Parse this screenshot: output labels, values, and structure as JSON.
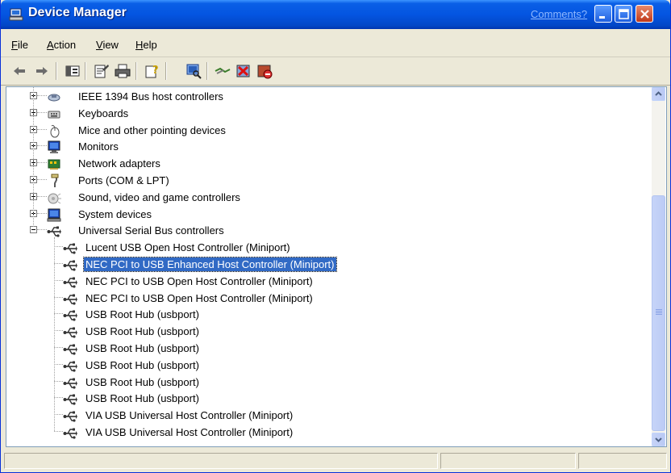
{
  "window": {
    "title": "Device Manager",
    "comments_link": "Comments?"
  },
  "menu": [
    "File",
    "Action",
    "View",
    "Help"
  ],
  "toolbar_icons": [
    "back-arrow-icon",
    "forward-arrow-icon",
    "show-hide-tree-icon",
    "properties-icon",
    "print-icon",
    "help-icon",
    "scan-hardware-icon",
    "update-driver-icon",
    "uninstall-icon",
    "disable-device-icon"
  ],
  "tree": {
    "categories": [
      {
        "label": "IEEE 1394 Bus host controllers",
        "icon": "ieee1394-icon",
        "expanded": false
      },
      {
        "label": "Keyboards",
        "icon": "keyboard-icon",
        "expanded": false
      },
      {
        "label": "Mice and other pointing devices",
        "icon": "mouse-icon",
        "expanded": false
      },
      {
        "label": "Monitors",
        "icon": "monitor-icon",
        "expanded": false
      },
      {
        "label": "Network adapters",
        "icon": "network-adapter-icon",
        "expanded": false
      },
      {
        "label": "Ports (COM & LPT)",
        "icon": "port-icon",
        "expanded": false
      },
      {
        "label": "Sound, video and game controllers",
        "icon": "sound-icon",
        "expanded": false
      },
      {
        "label": "System devices",
        "icon": "system-icon",
        "expanded": false
      },
      {
        "label": "Universal Serial Bus controllers",
        "icon": "usb-icon",
        "expanded": true
      }
    ],
    "usb_children": [
      {
        "label": "Lucent USB Open Host Controller (Miniport)",
        "selected": false
      },
      {
        "label": "NEC PCI to USB Enhanced Host Controller (Miniport)",
        "selected": true
      },
      {
        "label": "NEC PCI to USB Open Host Controller (Miniport)",
        "selected": false
      },
      {
        "label": "NEC PCI to USB Open Host Controller (Miniport)",
        "selected": false
      },
      {
        "label": "USB Root Hub (usbport)",
        "selected": false
      },
      {
        "label": "USB Root Hub (usbport)",
        "selected": false
      },
      {
        "label": "USB Root Hub (usbport)",
        "selected": false
      },
      {
        "label": "USB Root Hub (usbport)",
        "selected": false
      },
      {
        "label": "USB Root Hub (usbport)",
        "selected": false
      },
      {
        "label": "USB Root Hub (usbport)",
        "selected": false
      },
      {
        "label": "VIA USB Universal Host Controller (Miniport)",
        "selected": false
      },
      {
        "label": "VIA USB Universal Host Controller (Miniport)",
        "selected": false
      }
    ]
  },
  "colors": {
    "title_bar": "#0455e1",
    "selection": "#316ac5",
    "close_button": "#c0391a"
  }
}
